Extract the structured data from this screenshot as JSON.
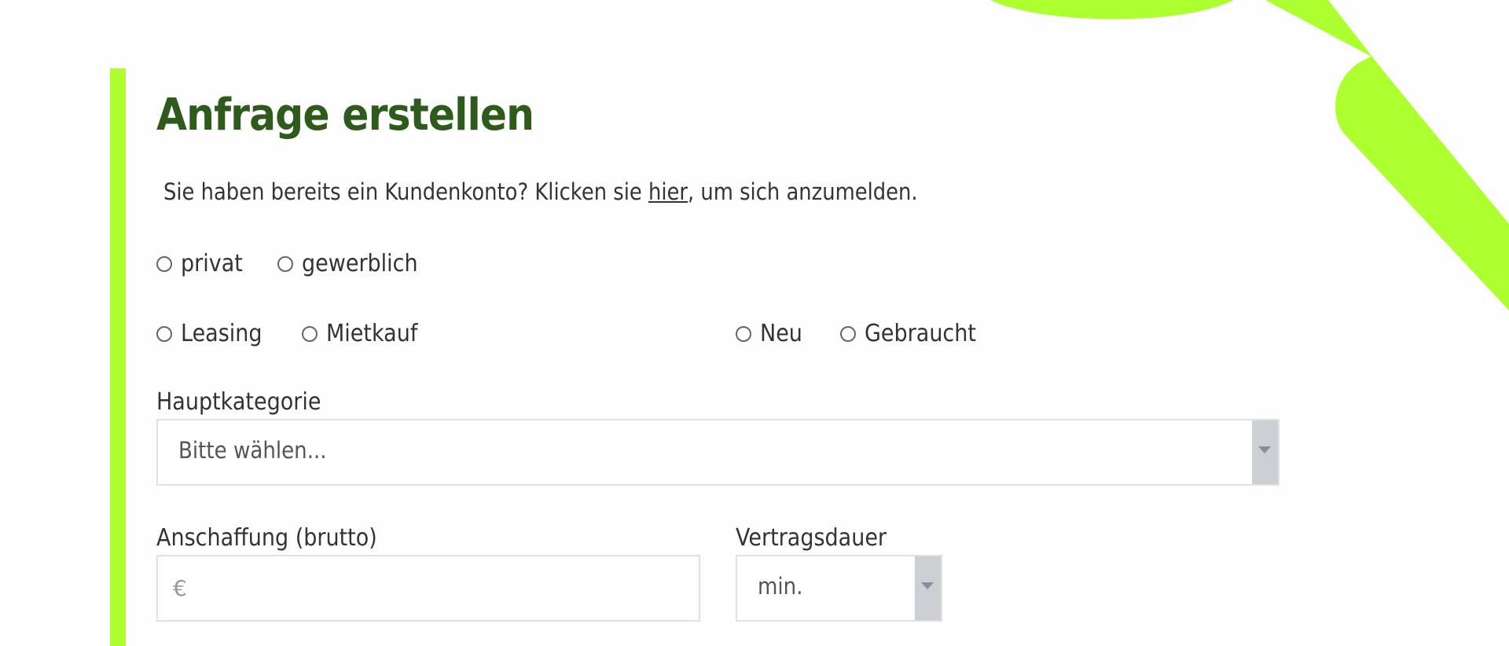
{
  "form": {
    "title": "Anfrage erstellen",
    "intro_before": "Sie haben bereits ein Kundenkonto? Klicken sie ",
    "intro_link": "hier",
    "intro_after": ", um sich anzumelden.",
    "customer_type_options": [
      "privat",
      "gewerblich"
    ],
    "financing_options": [
      "Leasing",
      "Mietkauf"
    ],
    "condition_options": [
      "Neu",
      "Gebraucht"
    ],
    "main_category": {
      "label": "Hauptkategorie",
      "selected": "Bitte wählen..."
    },
    "purchase_price": {
      "label": "Anschaffung (brutto)",
      "placeholder": "€",
      "value": ""
    },
    "contract_duration": {
      "label": "Vertragsdauer",
      "selected": "min."
    }
  },
  "colors": {
    "accent": "#adff2f",
    "title": "#2e5a1c"
  }
}
